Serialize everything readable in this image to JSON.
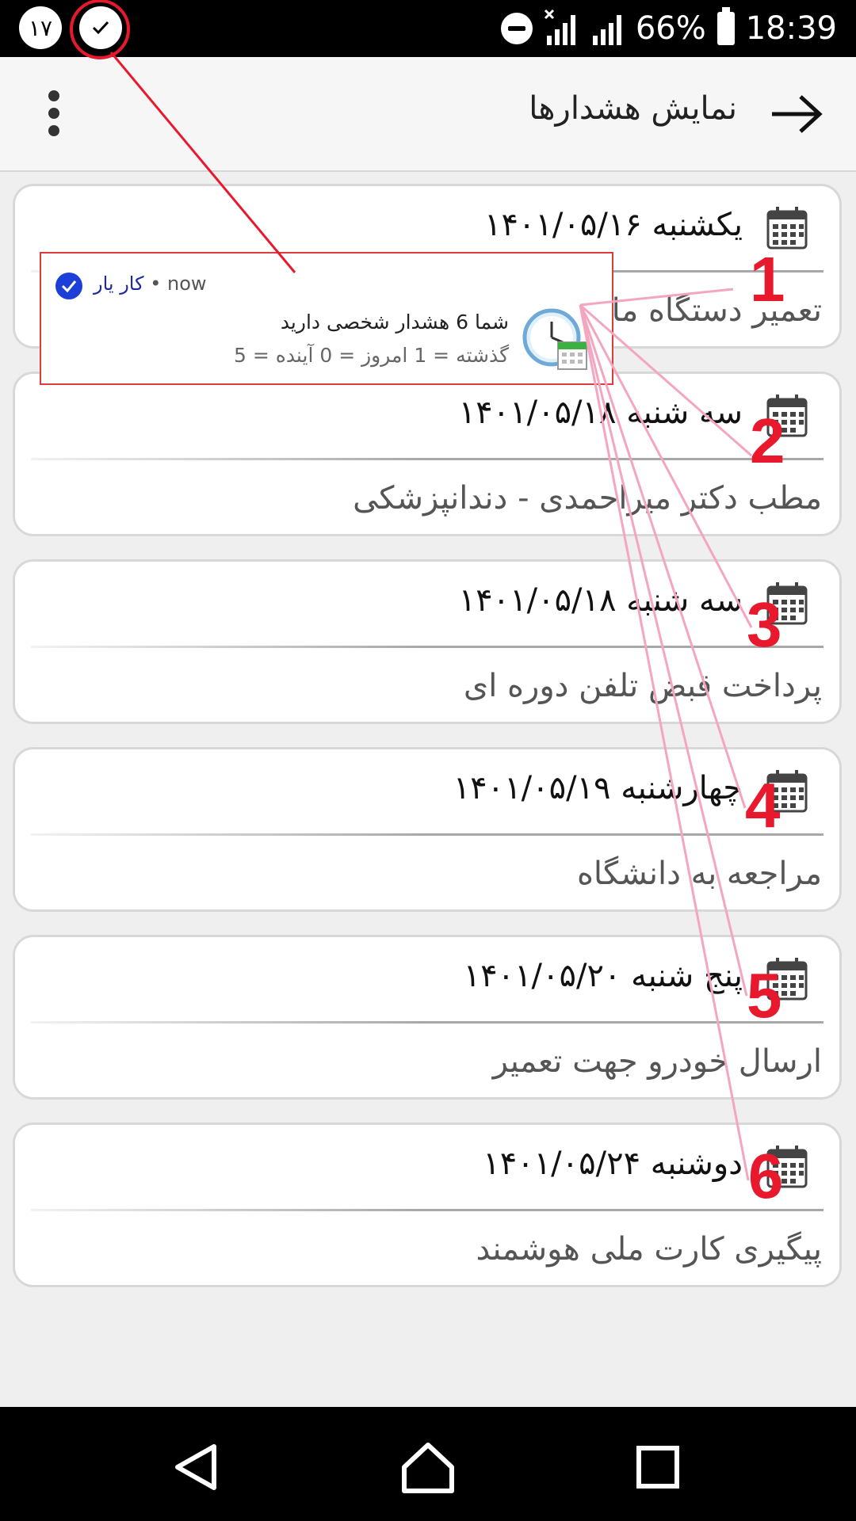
{
  "status_bar": {
    "left_badge": "۱۷",
    "battery": "66%",
    "time": "18:39"
  },
  "toolbar": {
    "title": "نمایش هشدارها"
  },
  "cards": [
    {
      "date": "یکشنبه  ۱۴۰۱/۰۵/۱۶",
      "text": "تعمیر دستگاه ما"
    },
    {
      "date": "سه شنبه  ۱۴۰۱/۰۵/۱۸",
      "text": "مطب دکتر میراحمدی - دندانپزشکی"
    },
    {
      "date": "سه شنبه  ۱۴۰۱/۰۵/۱۸",
      "text": "پرداخت قبض تلفن دوره ای"
    },
    {
      "date": "چهارشنبه  ۱۴۰۱/۰۵/۱۹",
      "text": "مراجعه به دانشگاه"
    },
    {
      "date": "پنج شنبه  ۱۴۰۱/۰۵/۲۰",
      "text": "ارسال خودرو جهت تعمیر"
    },
    {
      "date": "دوشنبه  ۱۴۰۱/۰۵/۲۴",
      "text": "پیگیری کارت ملی هوشمند"
    }
  ],
  "notification": {
    "app_name": "کار یار",
    "time": "now",
    "separator": "•",
    "title": "شما 6 هشدار شخصی دارید",
    "body": "گذشته = 1 امروز = 0 آینده = 5"
  },
  "annotations": {
    "color": "#e8192c",
    "line_color": "#f4a6c0",
    "labels": [
      "1",
      "2",
      "3",
      "4",
      "5",
      "6"
    ]
  }
}
